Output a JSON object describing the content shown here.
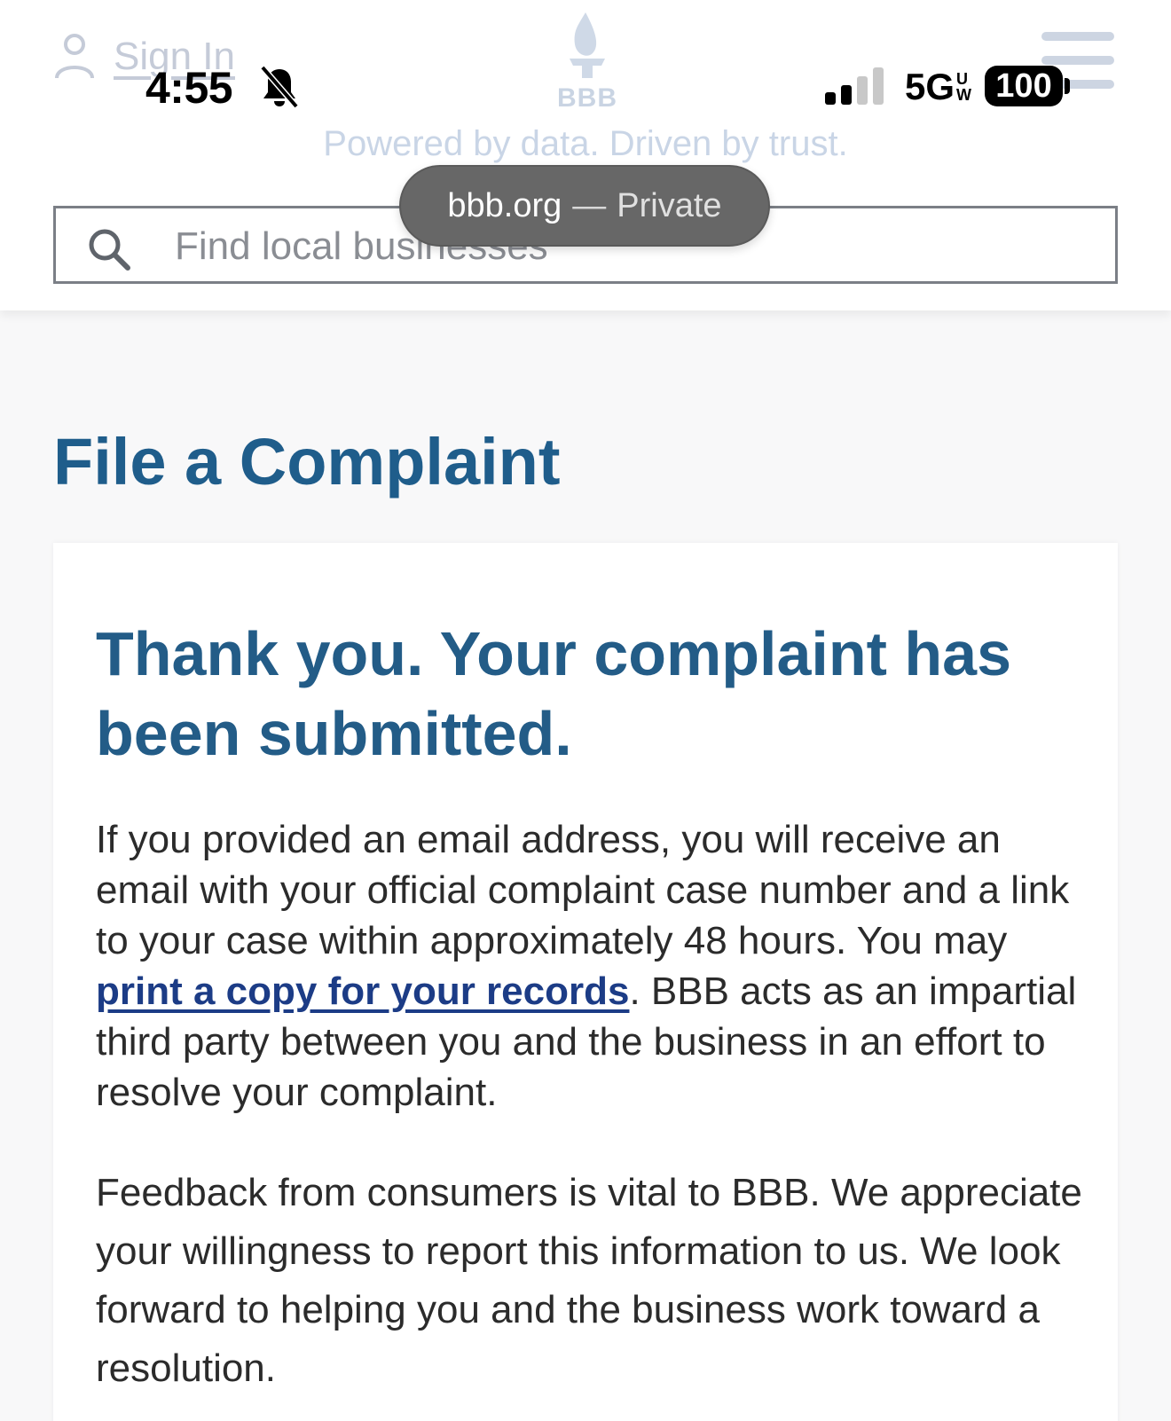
{
  "header": {
    "signin_label": "Sign In",
    "logo_text": "BBB",
    "tagline": "Powered by data. Driven by trust.",
    "search_placeholder": "Find local businesses"
  },
  "status_bar": {
    "time": "4:55",
    "network": "5G",
    "network_suffix_top": "U",
    "network_suffix_bottom": "W",
    "battery": "100"
  },
  "browser": {
    "domain": "bbb.org",
    "separator": "—",
    "mode": "Private"
  },
  "main": {
    "page_title": "File a Complaint",
    "card_heading": "Thank you. Your complaint has been submitted.",
    "para1_before": "If you provided an email address, you will receive an email with your official complaint case number and a link to your case within approximately 48 hours. You may ",
    "para1_link": "print a copy for your records",
    "para1_after": ". BBB acts as an impartial third party between you and the business in an effort to resolve your complaint.",
    "para2": "Feedback from consumers is vital to BBB. We appreciate your willingness to report this information to us. We look forward to helping you and the business work toward a resolution."
  },
  "colors": {
    "brand_blue": "#1f5d8b",
    "link_blue": "#1c3c86"
  }
}
